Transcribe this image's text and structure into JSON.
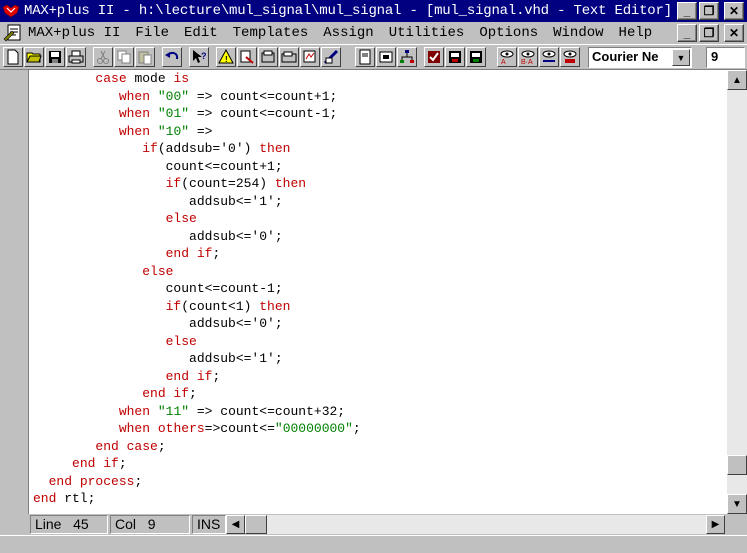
{
  "window": {
    "title": "MAX+plus II - h:\\lecture\\mul_signal\\mul_signal - [mul_signal.vhd - Text Editor]"
  },
  "menu": {
    "items": [
      {
        "label": "MAX+plus II"
      },
      {
        "label": "File"
      },
      {
        "label": "Edit"
      },
      {
        "label": "Templates"
      },
      {
        "label": "Assign"
      },
      {
        "label": "Utilities"
      },
      {
        "label": "Options"
      },
      {
        "label": "Window"
      },
      {
        "label": "Help"
      }
    ]
  },
  "toolbar": {
    "font_name": "Courier Ne",
    "font_size": "9"
  },
  "editor": {
    "lines": [
      [
        {
          "t": "        "
        },
        {
          "t": "case",
          "c": "k"
        },
        {
          "t": " mode "
        },
        {
          "t": "is",
          "c": "k"
        }
      ],
      [
        {
          "t": "           "
        },
        {
          "t": "when",
          "c": "k"
        },
        {
          "t": " "
        },
        {
          "t": "\"00\"",
          "c": "s"
        },
        {
          "t": " => count<=count+1;"
        }
      ],
      [
        {
          "t": "           "
        },
        {
          "t": "when",
          "c": "k"
        },
        {
          "t": " "
        },
        {
          "t": "\"01\"",
          "c": "s"
        },
        {
          "t": " => count<=count-1;"
        }
      ],
      [
        {
          "t": "           "
        },
        {
          "t": "when",
          "c": "k"
        },
        {
          "t": " "
        },
        {
          "t": "\"10\"",
          "c": "s"
        },
        {
          "t": " =>"
        }
      ],
      [
        {
          "t": "              "
        },
        {
          "t": "if",
          "c": "k"
        },
        {
          "t": "(addsub='0') "
        },
        {
          "t": "then",
          "c": "k"
        }
      ],
      [
        {
          "t": "                 count<=count+1;"
        }
      ],
      [
        {
          "t": "                 "
        },
        {
          "t": "if",
          "c": "k"
        },
        {
          "t": "(count=254) "
        },
        {
          "t": "then",
          "c": "k"
        }
      ],
      [
        {
          "t": "                    addsub<='1';"
        }
      ],
      [
        {
          "t": "                 "
        },
        {
          "t": "else",
          "c": "k"
        }
      ],
      [
        {
          "t": "                    addsub<='0';"
        }
      ],
      [
        {
          "t": "                 "
        },
        {
          "t": "end if",
          "c": "k"
        },
        {
          "t": ";"
        }
      ],
      [
        {
          "t": "              "
        },
        {
          "t": "else",
          "c": "k"
        }
      ],
      [
        {
          "t": "                 count<=count-1;"
        }
      ],
      [
        {
          "t": "                 "
        },
        {
          "t": "if",
          "c": "k"
        },
        {
          "t": "(count<1) "
        },
        {
          "t": "then",
          "c": "k"
        }
      ],
      [
        {
          "t": "                    addsub<='0';"
        }
      ],
      [
        {
          "t": "                 "
        },
        {
          "t": "else",
          "c": "k"
        }
      ],
      [
        {
          "t": "                    addsub<='1';"
        }
      ],
      [
        {
          "t": "                 "
        },
        {
          "t": "end if",
          "c": "k"
        },
        {
          "t": ";"
        }
      ],
      [
        {
          "t": "              "
        },
        {
          "t": "end if",
          "c": "k"
        },
        {
          "t": ";"
        }
      ],
      [
        {
          "t": "           "
        },
        {
          "t": "when",
          "c": "k"
        },
        {
          "t": " "
        },
        {
          "t": "\"11\"",
          "c": "s"
        },
        {
          "t": " => count<=count+32;"
        }
      ],
      [
        {
          "t": "           "
        },
        {
          "t": "when",
          "c": "k"
        },
        {
          "t": " "
        },
        {
          "t": "others",
          "c": "k"
        },
        {
          "t": "=>count<="
        },
        {
          "t": "\"00000000\"",
          "c": "s"
        },
        {
          "t": ";"
        }
      ],
      [
        {
          "t": "        "
        },
        {
          "t": "end case",
          "c": "k"
        },
        {
          "t": ";"
        }
      ],
      [
        {
          "t": "     "
        },
        {
          "t": "end if",
          "c": "k"
        },
        {
          "t": ";"
        }
      ],
      [
        {
          "t": "  "
        },
        {
          "t": "end process",
          "c": "k"
        },
        {
          "t": ";"
        }
      ],
      [
        {
          "t": ""
        },
        {
          "t": "end",
          "c": "k"
        },
        {
          "t": " rtl;"
        }
      ]
    ]
  },
  "status": {
    "line_label": "Line",
    "line_value": "45",
    "col_label": "Col",
    "col_value": "9",
    "mode": "INS"
  },
  "colors": {
    "keyword": "#c00000",
    "string": "#008000",
    "titlebar": "#000080"
  }
}
